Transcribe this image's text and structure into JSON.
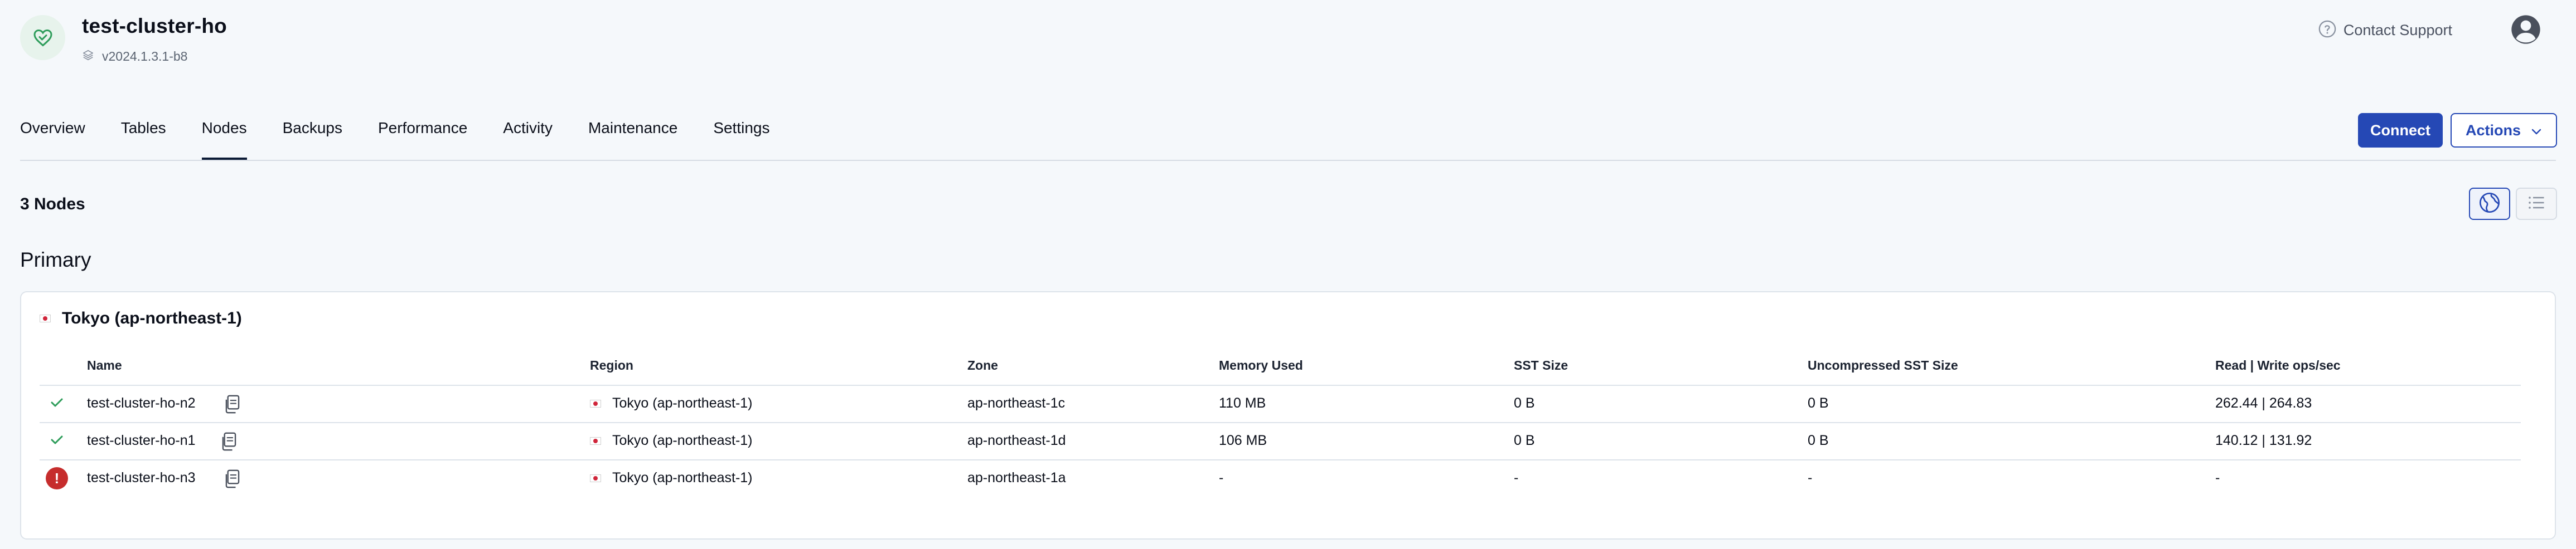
{
  "header": {
    "cluster_name": "test-cluster-ho",
    "version": "v2024.1.3.1-b8",
    "contact_support": "Contact Support"
  },
  "tabs": [
    {
      "label": "Overview"
    },
    {
      "label": "Tables"
    },
    {
      "label": "Nodes",
      "active": true
    },
    {
      "label": "Backups"
    },
    {
      "label": "Performance"
    },
    {
      "label": "Activity"
    },
    {
      "label": "Maintenance"
    },
    {
      "label": "Settings"
    }
  ],
  "buttons": {
    "connect": "Connect",
    "actions": "Actions"
  },
  "summary": {
    "nodes_count": "3 Nodes",
    "section_title": "Primary"
  },
  "region": {
    "title": "Tokyo (ap-northeast-1)"
  },
  "table": {
    "columns": [
      "Name",
      "Region",
      "Zone",
      "Memory Used",
      "SST Size",
      "Uncompressed SST Size",
      "Read | Write ops/sec"
    ],
    "rows": [
      {
        "status": "ok",
        "name": "test-cluster-ho-n2",
        "region": "Tokyo (ap-northeast-1)",
        "zone": "ap-northeast-1c",
        "memory": "110 MB",
        "sst": "0 B",
        "uncompressed": "0 B",
        "ops": "262.44 | 264.83"
      },
      {
        "status": "ok",
        "name": "test-cluster-ho-n1",
        "region": "Tokyo (ap-northeast-1)",
        "zone": "ap-northeast-1d",
        "memory": "106 MB",
        "sst": "0 B",
        "uncompressed": "0 B",
        "ops": "140.12 | 131.92"
      },
      {
        "status": "error",
        "name": "test-cluster-ho-n3",
        "region": "Tokyo (ap-northeast-1)",
        "zone": "ap-northeast-1a",
        "memory": "-",
        "sst": "-",
        "uncompressed": "-",
        "ops": "-"
      }
    ]
  },
  "colors": {
    "primary": "#2548b5",
    "success": "#2e9d5b",
    "error": "#c62d2d",
    "background": "#f5f8fb"
  },
  "icons": {
    "cluster": "heart-check-icon",
    "version": "layers-icon",
    "support": "question-circle-icon",
    "avatar": "user-avatar-icon",
    "actions": "chevron-down-icon",
    "map_view": "globe-icon",
    "list_view": "list-icon",
    "status_ok": "check-icon",
    "status_error": "exclamation-icon",
    "copy": "copy-icon",
    "flag": "japan-flag-icon"
  }
}
